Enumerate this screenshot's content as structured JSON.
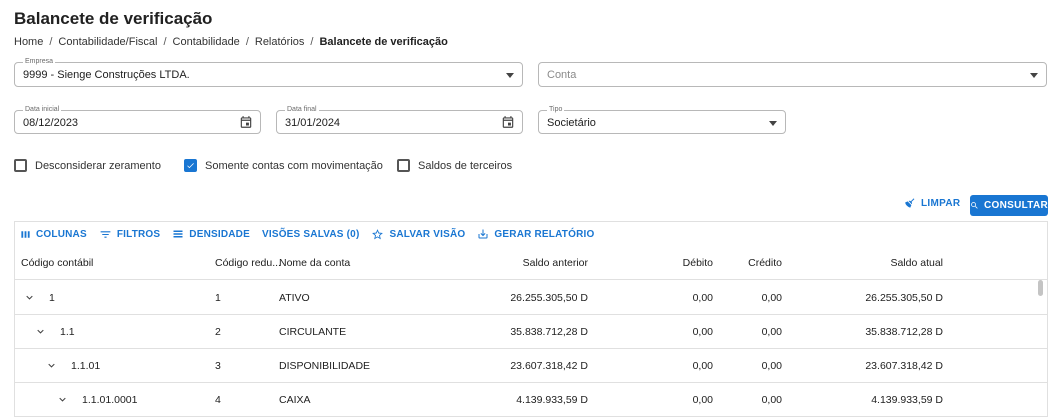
{
  "page": {
    "title": "Balancete de verificação"
  },
  "breadcrumb": [
    "Home",
    "Contabilidade/Fiscal",
    "Contabilidade",
    "Relatórios",
    "Balancete de verificação"
  ],
  "filters": {
    "empresa": {
      "label": "Empresa",
      "value": "9999 - Sienge Construções LTDA."
    },
    "conta": {
      "placeholder": "Conta"
    },
    "data_inicial": {
      "label": "Data inicial",
      "value": "08/12/2023"
    },
    "data_final": {
      "label": "Data final",
      "value": "31/01/2024"
    },
    "tipo": {
      "label": "Tipo",
      "value": "Societário"
    }
  },
  "checkboxes": [
    {
      "label": "Desconsiderar zeramento",
      "checked": false
    },
    {
      "label": "Somente contas com movimentação",
      "checked": true
    },
    {
      "label": "Saldos de terceiros",
      "checked": false
    }
  ],
  "actions": {
    "limpar": "LIMPAR",
    "consultar": "CONSULTAR"
  },
  "toolbar": {
    "colunas": "COLUNAS",
    "filtros": "FILTROS",
    "densidade": "DENSIDADE",
    "visoes": "VISÕES SALVAS (0)",
    "salvar": "SALVAR VISÃO",
    "gerar": "GERAR RELATÓRIO"
  },
  "table": {
    "columns": [
      "Código contábil",
      "Código redu...",
      "Nome da conta",
      "Saldo anterior",
      "Débito",
      "Crédito",
      "Saldo atual"
    ],
    "rows": [
      {
        "codigo": "1",
        "reduzido": "1",
        "nome": "ATIVO",
        "saldo_anterior": "26.255.305,50 D",
        "debito": "0,00",
        "credito": "0,00",
        "saldo_atual": "26.255.305,50 D",
        "level": 0
      },
      {
        "codigo": "1.1",
        "reduzido": "2",
        "nome": "CIRCULANTE",
        "saldo_anterior": "35.838.712,28 D",
        "debito": "0,00",
        "credito": "0,00",
        "saldo_atual": "35.838.712,28 D",
        "level": 1
      },
      {
        "codigo": "1.1.01",
        "reduzido": "3",
        "nome": "DISPONIBILIDADE",
        "saldo_anterior": "23.607.318,42 D",
        "debito": "0,00",
        "credito": "0,00",
        "saldo_atual": "23.607.318,42 D",
        "level": 2
      },
      {
        "codigo": "1.1.01.0001",
        "reduzido": "4",
        "nome": "CAIXA",
        "saldo_anterior": "4.139.933,59 D",
        "debito": "0,00",
        "credito": "0,00",
        "saldo_atual": "4.139.933,59 D",
        "level": 3
      }
    ]
  },
  "colors": {
    "primary": "#1976d2",
    "border": "#e0e0e0"
  }
}
